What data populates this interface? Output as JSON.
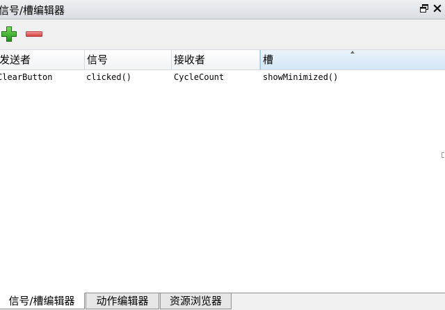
{
  "window": {
    "title": "信号/槽编辑器",
    "float_icon": "float-window-icon",
    "close_icon": "close-icon"
  },
  "toolbar": {
    "add_icon": "plus-icon",
    "remove_icon": "minus-icon",
    "colors": {
      "add": "#2fa82a",
      "remove": "#e25757"
    }
  },
  "table": {
    "columns": [
      "发送者",
      "信号",
      "接收者",
      "槽"
    ],
    "rows": [
      [
        "ClearButton",
        "clicked()",
        "CycleCount",
        "showMinimized()"
      ]
    ]
  },
  "tabs": [
    "信号/槽编辑器",
    "动作编辑器",
    "资源浏览器"
  ],
  "colors": {
    "selected_header": "#d3e7f6",
    "active_tab": "#ffffff"
  }
}
